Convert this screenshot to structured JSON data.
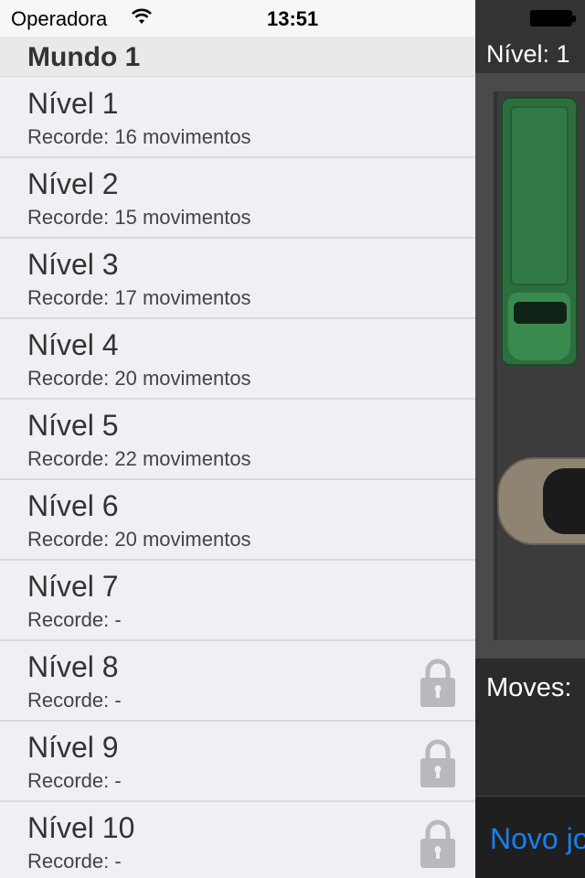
{
  "status_bar": {
    "carrier": "Operadora",
    "time": "13:51",
    "wifi_icon": "wifi-icon"
  },
  "menu": {
    "section_title": "Mundo 1",
    "levels": [
      {
        "title": "Nível 1",
        "record": "Recorde: 16 movimentos",
        "locked": false
      },
      {
        "title": "Nível 2",
        "record": "Recorde: 15 movimentos",
        "locked": false
      },
      {
        "title": "Nível 3",
        "record": "Recorde: 17 movimentos",
        "locked": false
      },
      {
        "title": "Nível 4",
        "record": "Recorde: 20 movimentos",
        "locked": false
      },
      {
        "title": "Nível 5",
        "record": "Recorde: 22 movimentos",
        "locked": false
      },
      {
        "title": "Nível 6",
        "record": "Recorde: 20 movimentos",
        "locked": false
      },
      {
        "title": "Nível 7",
        "record": "Recorde: -",
        "locked": false
      },
      {
        "title": "Nível 8",
        "record": "Recorde: -",
        "locked": true
      },
      {
        "title": "Nível 9",
        "record": "Recorde: -",
        "locked": true
      },
      {
        "title": "Nível 10",
        "record": "Recorde: -",
        "locked": true
      }
    ],
    "lock_icon": "lock-icon"
  },
  "game": {
    "level_label": "Nível:  1",
    "moves_label": "Moves:",
    "new_game_label": "Novo jogo",
    "colors": {
      "accent": "#1a7ef0",
      "truck": "#2d6e3e",
      "car": "#8f8372"
    }
  }
}
